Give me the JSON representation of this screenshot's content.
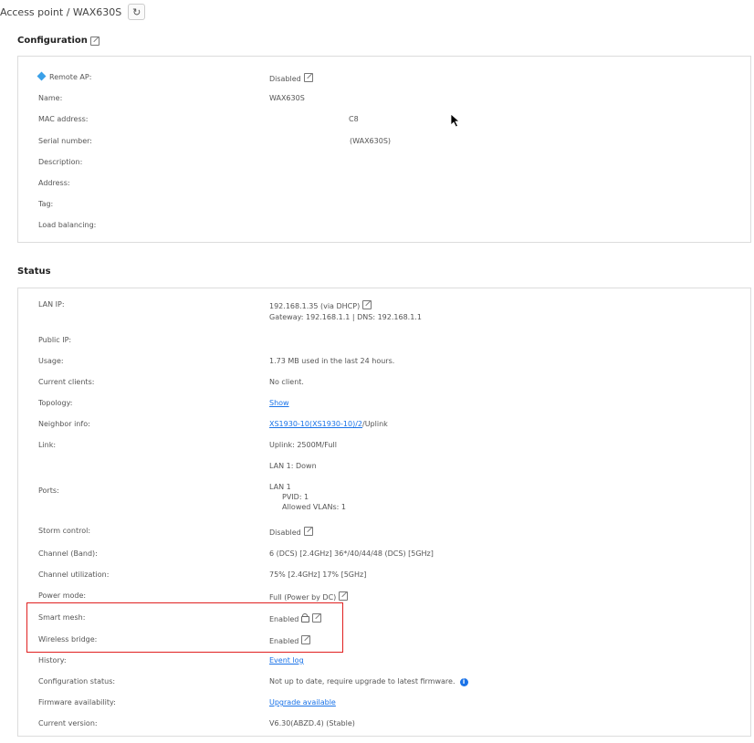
{
  "breadcrumb": {
    "text": "Access point / WAX630S"
  },
  "configuration": {
    "title": "Configuration",
    "rows": [
      {
        "label": "Remote AP:",
        "value": "Disabled"
      },
      {
        "label": "Name:",
        "value": "WAX630S"
      },
      {
        "label": "MAC address:",
        "value": "C8"
      },
      {
        "label": "Serial number:",
        "value": "(WAX630S)"
      },
      {
        "label": "Description:",
        "value": ""
      },
      {
        "label": "Address:",
        "value": ""
      },
      {
        "label": "Tag:",
        "value": ""
      },
      {
        "label": "Load balancing:",
        "value": ""
      }
    ]
  },
  "status": {
    "title": "Status",
    "lan_ip": {
      "label": "LAN IP:",
      "value": "192.168.1.35  (via DHCP)",
      "gateway": "Gateway: 192.168.1.1   |   DNS: 192.168.1.1"
    },
    "public_ip": {
      "label": "Public IP:",
      "value": ""
    },
    "usage": {
      "label": "Usage:",
      "value": "1.73 MB used in the last 24 hours."
    },
    "current_clients": {
      "label": "Current clients:",
      "value": "No client."
    },
    "topology": {
      "label": "Topology:",
      "link": "Show"
    },
    "neighbor_info": {
      "label": "Neighbor info:",
      "link": "XS1930-10(XS1930-10)/2",
      "suffix": "/Uplink"
    },
    "link": {
      "label": "Link:",
      "value": "Uplink: 2500M/Full",
      "value2": "LAN 1: Down"
    },
    "ports": {
      "label": "Ports:",
      "value": "LAN 1",
      "pvid": "PVID: 1",
      "vlans": "Allowed VLANs:  1"
    },
    "storm_control": {
      "label": "Storm control:",
      "value": "Disabled"
    },
    "channel_band": {
      "label": "Channel (Band):",
      "value": "6 (DCS) [2.4GHz] 36*/40/44/48 (DCS) [5GHz]"
    },
    "channel_util": {
      "label": "Channel utilization:",
      "value": "75% [2.4GHz] 17% [5GHz]"
    },
    "power_mode": {
      "label": "Power mode:",
      "value": "Full  (Power by DC)"
    },
    "smart_mesh": {
      "label": "Smart mesh:",
      "value": "Enabled"
    },
    "wireless_bridge": {
      "label": "Wireless bridge:",
      "value": "Enabled"
    },
    "history": {
      "label": "History:",
      "link": "Event log"
    },
    "config_status": {
      "label": "Configuration status:",
      "value": "Not up to date, require upgrade to latest firmware."
    },
    "firmware": {
      "label": "Firmware availability:",
      "link": "Upgrade available"
    },
    "current_version": {
      "label": "Current version:",
      "value": "V6.30(ABZD.4) (Stable)"
    }
  },
  "icons": {
    "refresh": "refresh-icon",
    "edit": "edit-icon",
    "lock": "lock-icon",
    "info": "info-icon",
    "remote": "diamond-icon"
  },
  "colors": {
    "link": "#1a73e8",
    "highlight": "#e02020",
    "info": "#1a73e8",
    "remote": "#3aa0e8"
  }
}
